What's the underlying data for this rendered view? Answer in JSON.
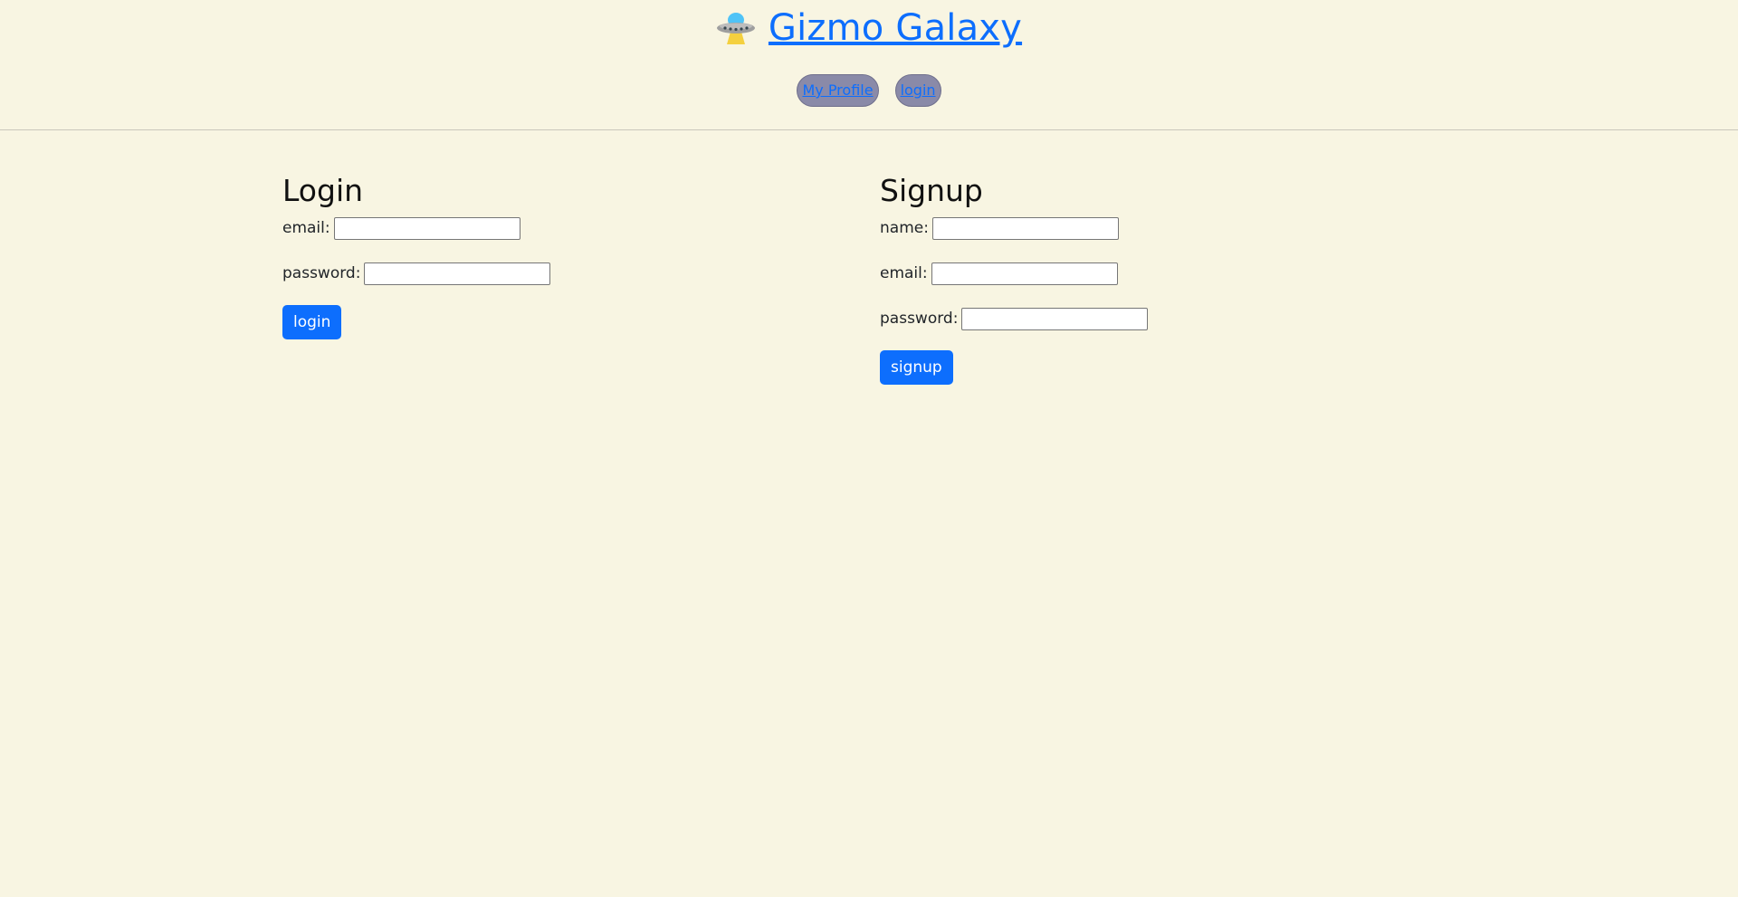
{
  "header": {
    "logo_icon": "flying-saucer-icon",
    "site_title": "Gizmo Galaxy",
    "nav": [
      {
        "label": "My Profile"
      },
      {
        "label": "login"
      }
    ]
  },
  "login": {
    "title": "Login",
    "email_label": "email:",
    "email_value": "",
    "password_label": "password:",
    "password_value": "",
    "button_label": "login"
  },
  "signup": {
    "title": "Signup",
    "name_label": "name:",
    "name_value": "",
    "email_label": "email:",
    "email_value": "",
    "password_label": "password:",
    "password_value": "",
    "button_label": "signup"
  },
  "colors": {
    "background": "#f8f5e2",
    "accent": "#0d6efd",
    "nav_pill": "#8a8aa8"
  }
}
